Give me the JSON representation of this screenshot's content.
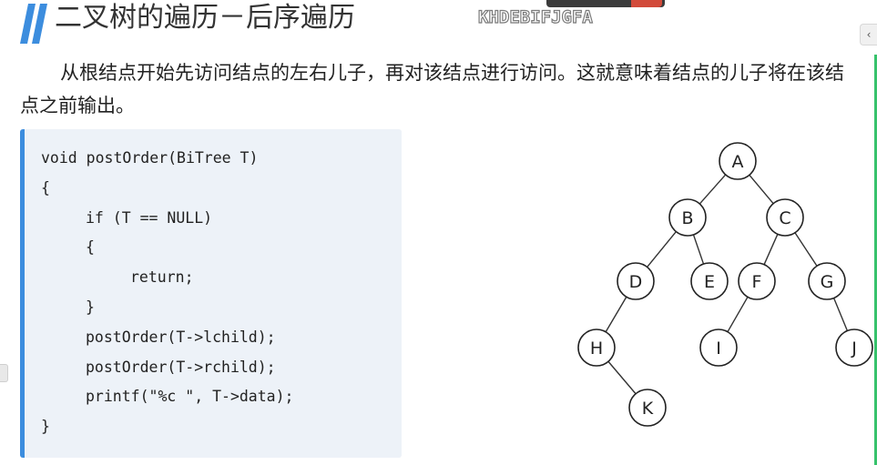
{
  "header": {
    "title": "二叉树的遍历－后序遍历",
    "watermark": "KHDEBIFJGFA",
    "accent_color": "#3c8dde"
  },
  "intro": {
    "text": "从根结点开始先访问结点的左右儿子，再对该结点进行访问。这就意味着结点的儿子将在该结点之前输出。"
  },
  "code": {
    "lines": [
      {
        "indent": 0,
        "text": "void postOrder(BiTree T)"
      },
      {
        "indent": 0,
        "text": "{"
      },
      {
        "indent": 1,
        "text": "if (T == NULL)"
      },
      {
        "indent": 1,
        "text": "{"
      },
      {
        "indent": 2,
        "text": "return;"
      },
      {
        "indent": 1,
        "text": "}"
      },
      {
        "indent": 1,
        "text": "postOrder(T->lchild);"
      },
      {
        "indent": 1,
        "text": "postOrder(T->rchild);"
      },
      {
        "indent": 1,
        "text": "printf(\"%c \", T->data);"
      },
      {
        "indent": 0,
        "text": "}"
      }
    ]
  },
  "tree": {
    "nodes": [
      {
        "id": "A",
        "label": "A"
      },
      {
        "id": "B",
        "label": "B"
      },
      {
        "id": "C",
        "label": "C"
      },
      {
        "id": "D",
        "label": "D"
      },
      {
        "id": "E",
        "label": "E"
      },
      {
        "id": "F",
        "label": "F"
      },
      {
        "id": "G",
        "label": "G"
      },
      {
        "id": "H",
        "label": "H"
      },
      {
        "id": "I",
        "label": "I"
      },
      {
        "id": "J",
        "label": "J"
      },
      {
        "id": "K",
        "label": "K"
      }
    ],
    "edges": [
      [
        "A",
        "B"
      ],
      [
        "A",
        "C"
      ],
      [
        "B",
        "D"
      ],
      [
        "B",
        "E"
      ],
      [
        "C",
        "F"
      ],
      [
        "C",
        "G"
      ],
      [
        "D",
        "H"
      ],
      [
        "H",
        "K"
      ],
      [
        "F",
        "I"
      ],
      [
        "G",
        "J"
      ]
    ]
  },
  "ui": {
    "side_handle_icon": "chevron-left-icon",
    "side_handle_glyph": "‹"
  }
}
